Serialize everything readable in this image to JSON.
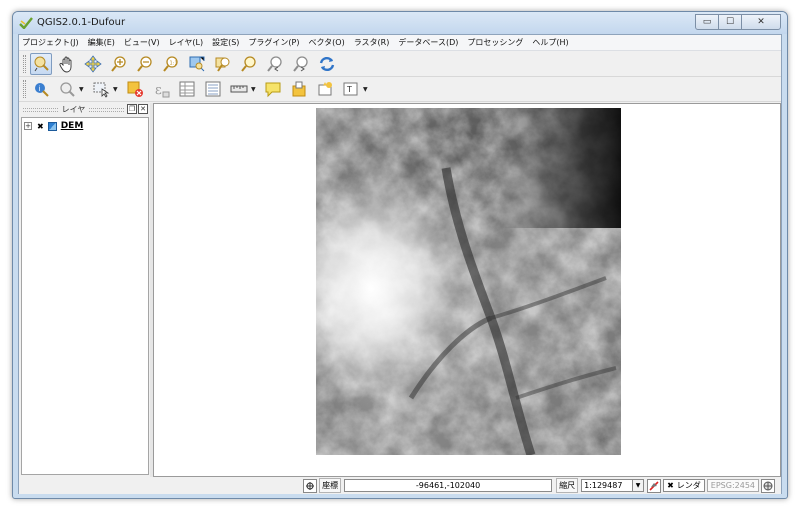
{
  "window": {
    "title": "QGIS2.0.1-Dufour",
    "controls": {
      "minimize": "▭",
      "maximize": "☐",
      "close": "✕"
    }
  },
  "menu": [
    "プロジェクト(J)",
    "編集(E)",
    "ビュー(V)",
    "レイヤ(L)",
    "設定(S)",
    "プラグイン(P)",
    "ベクタ(O)",
    "ラスタ(R)",
    "データベース(D)",
    "プロセッシング",
    "ヘルプ(H)"
  ],
  "toolbar_nav": {
    "icons": [
      "pan-map-icon",
      "pan-hand-icon",
      "pan-to-selection-icon",
      "zoom-in-icon",
      "zoom-out-icon",
      "zoom-actual-size-icon",
      "zoom-full-icon",
      "zoom-to-layer-icon",
      "zoom-to-selection-icon",
      "zoom-last-icon",
      "zoom-next-icon",
      "refresh-icon"
    ]
  },
  "toolbar_attr": {
    "icons": [
      "identify-icon",
      "select-features-icon",
      "select-by-area-icon",
      "deselect-icon",
      "field-calculator-icon",
      "attribute-table-icon",
      "statistics-icon",
      "measure-icon",
      "map-tips-icon",
      "bookmarks-icon",
      "new-bookmark-icon",
      "text-annotation-icon"
    ]
  },
  "layers_panel": {
    "title": "レイヤ",
    "layers": [
      {
        "name": "DEM",
        "visible_mark": "✖",
        "expander": "+"
      }
    ]
  },
  "statusbar": {
    "coord_label": "座標",
    "coord_value": "-96461,-102040",
    "scale_label": "縮尺",
    "scale_value": "1:129487",
    "render_label": "レンダ",
    "render_mark": "✖",
    "crs": "EPSG:2454"
  },
  "colors": {
    "titlebar": "#c9dcef",
    "accent": "#3a78c2",
    "dem_low": "#0d0d0d",
    "dem_high": "#ffffff"
  }
}
